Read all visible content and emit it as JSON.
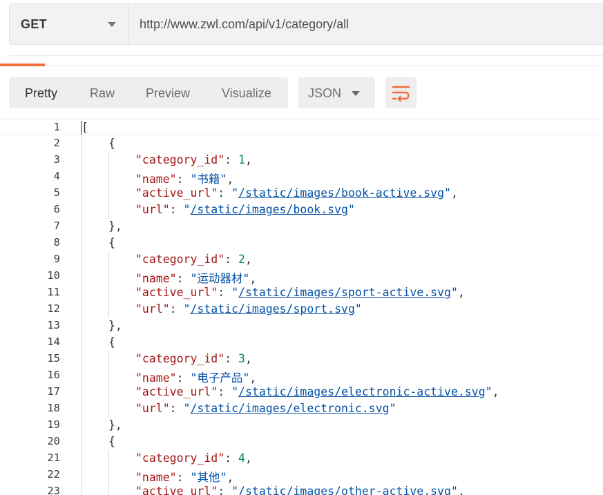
{
  "request": {
    "method": "GET",
    "url": "http://www.zwl.com/api/v1/category/all"
  },
  "response_toolbar": {
    "view_tabs": [
      "Pretty",
      "Raw",
      "Preview",
      "Visualize"
    ],
    "active_view": "Pretty",
    "format": "JSON"
  },
  "editor": {
    "line_numbers": [
      "1",
      "2",
      "3",
      "4",
      "5",
      "6",
      "7",
      "8",
      "9",
      "10",
      "11",
      "12",
      "13",
      "14",
      "15",
      "16",
      "17",
      "18",
      "19",
      "20",
      "21",
      "22",
      "23"
    ],
    "items": [
      {
        "category_id": "1",
        "name": "书籍",
        "active_url": "/static/images/book-active.svg",
        "url": "/static/images/book.svg"
      },
      {
        "category_id": "2",
        "name": "运动器材",
        "active_url": "/static/images/sport-active.svg",
        "url": "/static/images/sport.svg"
      },
      {
        "category_id": "3",
        "name": "电子产品",
        "active_url": "/static/images/electronic-active.svg",
        "url": "/static/images/electronic.svg"
      },
      {
        "category_id": "4",
        "name": "其他",
        "active_url": "/static/images/other-active.svg"
      }
    ]
  },
  "colors": {
    "accent": "#f26b3a",
    "key": "#a31515",
    "number": "#098658",
    "string": "#0451a5"
  },
  "icons": {
    "method_dropdown": "chevron-down-icon",
    "format_dropdown": "chevron-down-icon",
    "wrap": "wrap-lines-icon"
  }
}
